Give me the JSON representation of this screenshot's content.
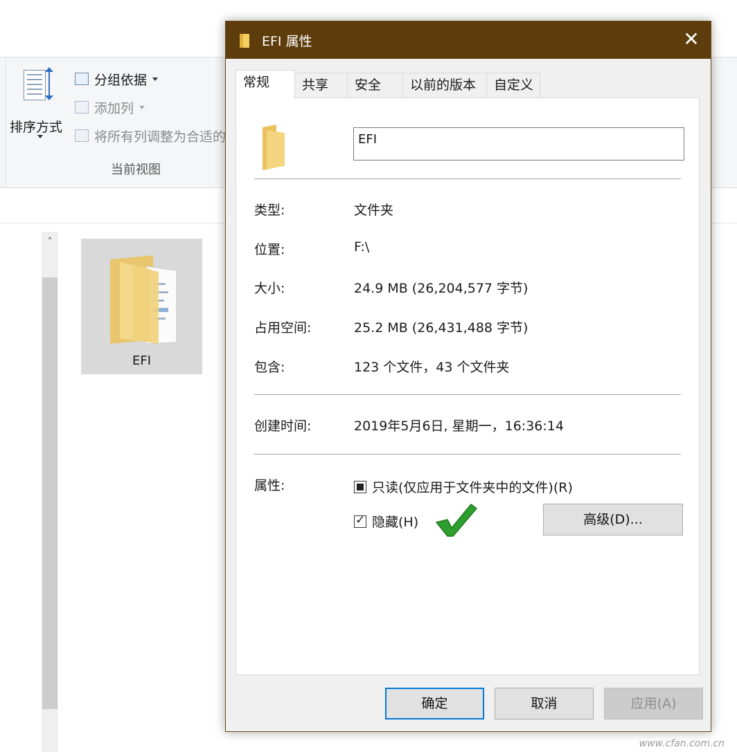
{
  "explorer": {
    "ribbon": {
      "sort_label": "排序方式",
      "group_by_label": "分组依据",
      "add_column_label": "添加列",
      "fit_columns_label": "将所有列调整为合适的",
      "group_title": "当前视图"
    },
    "scroll_up_glyph": "˄",
    "file_item": {
      "name": "EFI",
      "icon": "folder-icon"
    }
  },
  "dialog": {
    "title": "EFI 属性",
    "title_icon": "folder-icon",
    "close_glyph": "✕",
    "tabs": [
      {
        "label": "常规",
        "active": true
      },
      {
        "label": "共享",
        "active": false
      },
      {
        "label": "安全",
        "active": false
      },
      {
        "label": "以前的版本",
        "active": false
      },
      {
        "label": "自定义",
        "active": false
      }
    ],
    "general": {
      "name_value": "EFI",
      "type_label": "类型:",
      "type_value": "文件夹",
      "location_label": "位置:",
      "location_value": "F:\\",
      "size_label": "大小:",
      "size_value": "24.9 MB (26,204,577 字节)",
      "size_on_disk_label": "占用空间:",
      "size_on_disk_value": "25.2 MB (26,431,488 字节)",
      "contains_label": "包含:",
      "contains_value": "123 个文件，43 个文件夹",
      "created_label": "创建时间:",
      "created_value": "2019年5月6日, 星期一，16:36:14",
      "attributes_label": "属性:",
      "readonly_label": "只读(仅应用于文件夹中的文件)(R)",
      "readonly_state": "indeterminate",
      "hidden_label": "隐藏(H)",
      "hidden_state": "checked",
      "advanced_button": "高级(D)..."
    },
    "buttons": {
      "ok": "确定",
      "cancel": "取消",
      "apply": "应用(A)"
    }
  },
  "annotation": {
    "icon": "green-checkmark-icon",
    "color": "#2e9e2e"
  },
  "watermark": "www.cfan.com.cn",
  "colors": {
    "titlebar": "#5e3d0c",
    "default_button_border": "#0078d7",
    "folder": "#f4cf62"
  }
}
